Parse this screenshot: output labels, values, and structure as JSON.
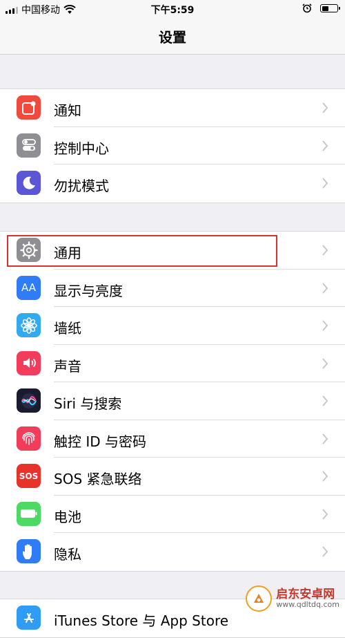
{
  "status": {
    "carrier": "中国移动",
    "time": "下午5:59"
  },
  "nav": {
    "title": "设置"
  },
  "groups": [
    {
      "items": [
        {
          "label": "通知",
          "icon": "notifications-icon",
          "color": "#f2493f"
        },
        {
          "label": "控制中心",
          "icon": "control-center-icon",
          "color": "#8e8e93"
        },
        {
          "label": "勿扰模式",
          "icon": "moon-icon",
          "color": "#5b56d6"
        }
      ]
    },
    {
      "items": [
        {
          "label": "通用",
          "icon": "gear-icon",
          "color": "#8e8e93"
        },
        {
          "label": "显示与亮度",
          "icon": "text-size-icon",
          "color": "#2f7cf6",
          "icon_text": "AA"
        },
        {
          "label": "墙纸",
          "icon": "flower-icon",
          "color": "#33aaf0"
        },
        {
          "label": "声音",
          "icon": "speaker-icon",
          "color": "#f23c5c"
        },
        {
          "label": "Siri 与搜索",
          "icon": "siri-icon",
          "color": "#1b1b2e"
        },
        {
          "label": "触控 ID 与密码",
          "icon": "fingerprint-icon",
          "color": "#f23c5c"
        },
        {
          "label": "SOS 紧急联络",
          "icon": "sos-icon",
          "color": "#e8332a",
          "icon_text": "SOS"
        },
        {
          "label": "电池",
          "icon": "battery-icon",
          "color": "#4cd964"
        },
        {
          "label": "隐私",
          "icon": "hand-icon",
          "color": "#2f7cf6"
        }
      ]
    },
    {
      "items": [
        {
          "label": "iTunes Store 与 App Store",
          "icon": "app-store-icon",
          "color": "#2f9cf6"
        }
      ]
    }
  ],
  "watermark": {
    "name": "启东安卓网",
    "url": "www.qdltdq.com"
  }
}
